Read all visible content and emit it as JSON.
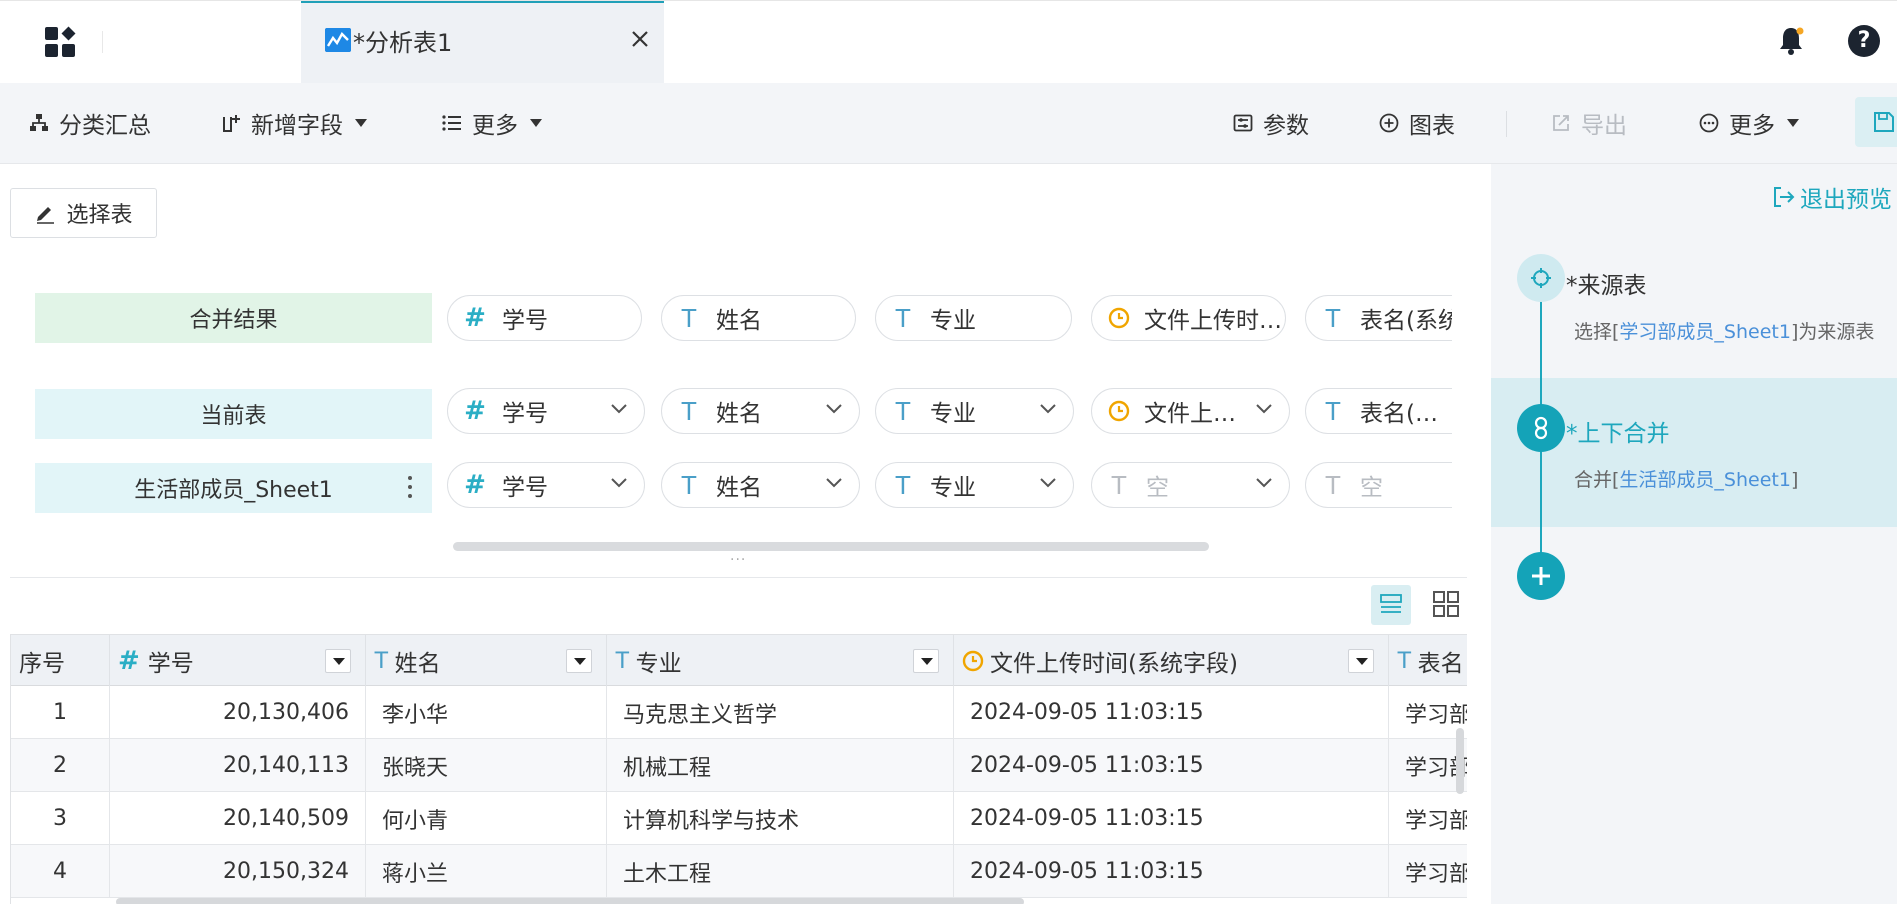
{
  "topbar": {
    "tab_title": "*分析表1"
  },
  "toolbar": {
    "summary": "分类汇总",
    "add_field": "新增字段",
    "more_left": "更多",
    "params": "参数",
    "chart": "图表",
    "export": "导出",
    "more_right": "更多"
  },
  "select_table_label": "选择表",
  "merge": {
    "result_label": "合并结果",
    "current_label": "当前表",
    "sheet_label": "生活部成员_Sheet1",
    "result_fields": [
      "学号",
      "姓名",
      "专业",
      "文件上传时…",
      "表名(系统"
    ],
    "current_fields": [
      "学号",
      "姓名",
      "专业",
      "文件上…",
      "表名(…"
    ],
    "sheet_fields": [
      "学号",
      "姓名",
      "专业",
      "空",
      "空"
    ],
    "dots": "···"
  },
  "grid": {
    "headers": [
      "序号",
      "学号",
      "姓名",
      "专业",
      "文件上传时间(系统字段)",
      "表名"
    ],
    "rows": [
      [
        "1",
        "20,130,406",
        "李小华",
        "马克思主义哲学",
        "2024-09-05 11:03:15",
        "学习部"
      ],
      [
        "2",
        "20,140,113",
        "张晓天",
        "机械工程",
        "2024-09-05 11:03:15",
        "学习部"
      ],
      [
        "3",
        "20,140,509",
        "何小青",
        "计算机科学与技术",
        "2024-09-05 11:03:15",
        "学习部"
      ],
      [
        "4",
        "20,150,324",
        "蒋小兰",
        "土木工程",
        "2024-09-05 11:03:15",
        "学习部"
      ]
    ]
  },
  "sidebar": {
    "exit_preview": "退出预览",
    "steps": [
      {
        "title": "*来源表",
        "desc_prefix": "选择[",
        "desc_link": "学习部成员_Sheet1",
        "desc_suffix": "]为来源表"
      },
      {
        "title": "*上下合并",
        "desc_prefix": "合并[",
        "desc_link": "生活部成员_Sheet1",
        "desc_suffix": "]"
      }
    ]
  },
  "colors": {
    "accent": "#1ea7bd",
    "result_bg": "#e1f4e7",
    "table_bg": "#e2f5f8"
  }
}
